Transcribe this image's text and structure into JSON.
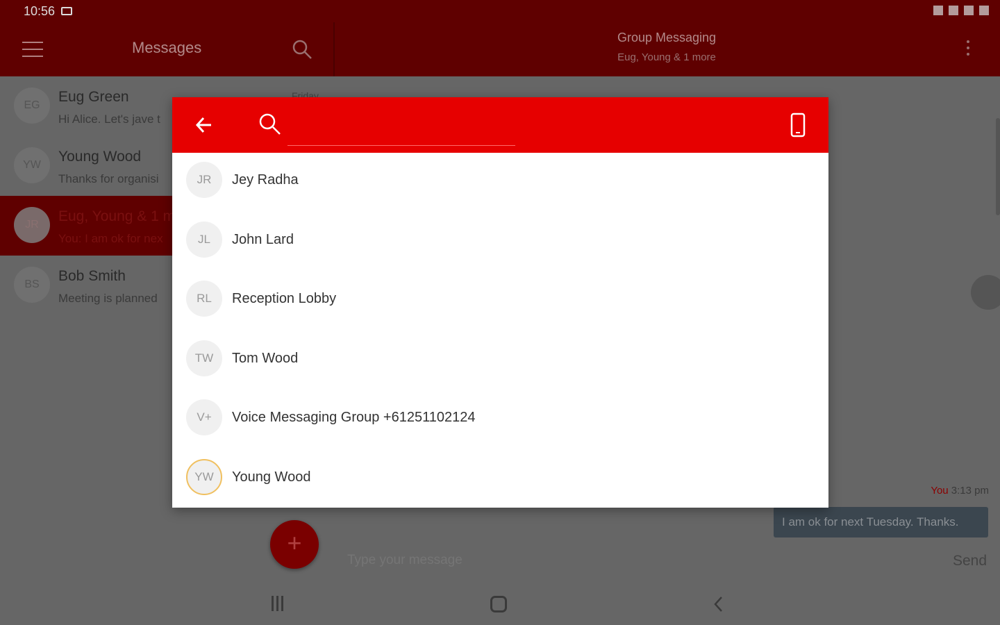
{
  "status_bar": {
    "time": "10:56"
  },
  "app_bar": {
    "title": "Messages",
    "conversation_title": "Group Messaging",
    "conversation_subtitle": "Eug, Young & 1 more"
  },
  "conversations": [
    {
      "initials": "EG",
      "name": "Eug Green",
      "preview": "Hi Alice. Let's jave t",
      "date": "Friday"
    },
    {
      "initials": "YW",
      "name": "Young Wood",
      "preview": "Thanks for organisi",
      "date": ""
    },
    {
      "initials": "JR",
      "name": "Eug, Young & 1 m",
      "preview": "You: I am ok for nex",
      "date": ""
    },
    {
      "initials": "BS",
      "name": "Bob Smith",
      "preview": "Meeting is planned",
      "date": ""
    }
  ],
  "message": {
    "sender": "You",
    "time": "3:13 pm",
    "text": "I am ok for next Tuesday. Thanks."
  },
  "compose": {
    "placeholder": "Type your message",
    "send_label": "Send",
    "fab_label": "+"
  },
  "dialog": {
    "search_value": "",
    "contacts": [
      {
        "initials": "JR",
        "name": "Jey Radha"
      },
      {
        "initials": "JL",
        "name": "John Lard"
      },
      {
        "initials": "RL",
        "name": "Reception Lobby"
      },
      {
        "initials": "TW",
        "name": "Tom Wood"
      },
      {
        "initials": "V+",
        "name": "Voice Messaging Group +61251102124"
      },
      {
        "initials": "YW",
        "name": "Young Wood"
      }
    ]
  },
  "colors": {
    "header_red": "#e60000",
    "dim_maroon": "#5f0000",
    "overlay_gray": "#666666"
  }
}
